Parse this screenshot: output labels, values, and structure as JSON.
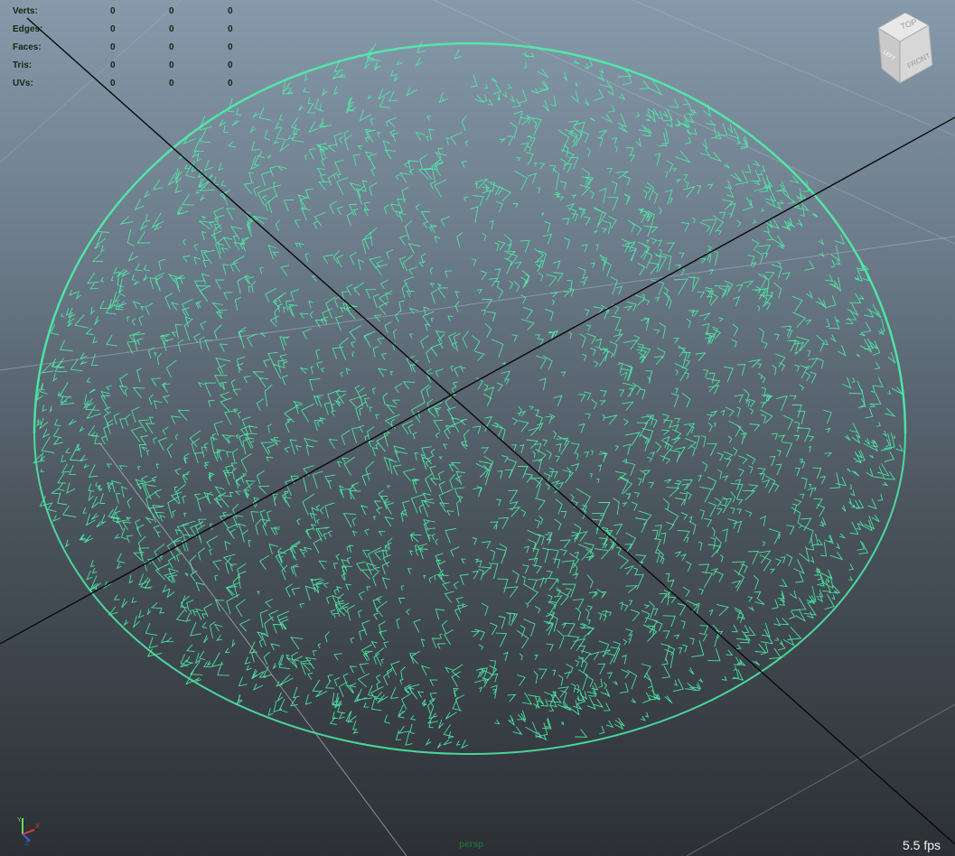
{
  "hud": {
    "rows": [
      {
        "label": "Verts:",
        "values": [
          "0",
          "0",
          "0"
        ]
      },
      {
        "label": "Edges:",
        "values": [
          "0",
          "0",
          "0"
        ]
      },
      {
        "label": "Faces:",
        "values": [
          "0",
          "0",
          "0"
        ]
      },
      {
        "label": "Tris:",
        "values": [
          "0",
          "0",
          "0"
        ]
      },
      {
        "label": "UVs:",
        "values": [
          "0",
          "0",
          "0"
        ]
      }
    ]
  },
  "viewcube": {
    "top": "TOP",
    "front": "FRONT",
    "left": "LEFT"
  },
  "axis_indicator": {
    "x_label": "X",
    "y_label": "Y",
    "z_label": "Z"
  },
  "camera_label": "persp",
  "fps": "5.5 fps",
  "colors": {
    "wire": "#4cf0a8",
    "hud_text": "#0e2a12",
    "fps_text": "#f2f2f2",
    "grid_line": "#b7c3cc",
    "axis_line": "#0a0a0a"
  },
  "icons": {
    "viewcube": "view-cube-icon",
    "axis": "axis-gizmo-icon"
  }
}
